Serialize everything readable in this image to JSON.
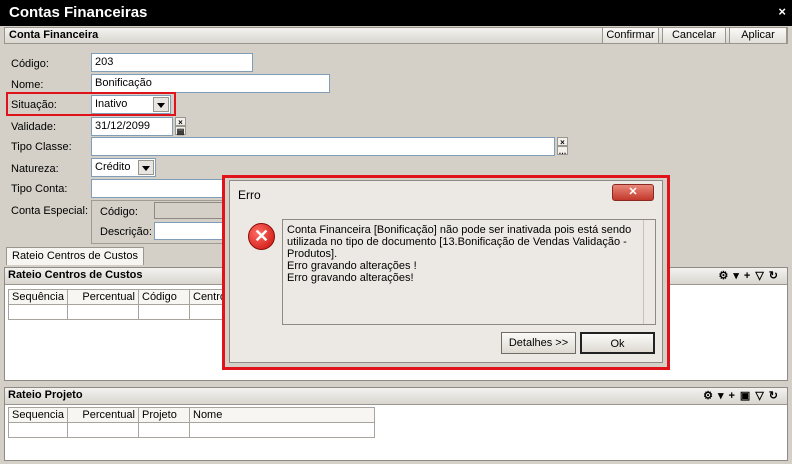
{
  "window": {
    "title": "Contas Financeiras",
    "close": "×"
  },
  "form": {
    "header": "Conta Financeira",
    "confirm": "Confirmar",
    "cancel": "Cancelar",
    "apply": "Aplicar",
    "codigo_label": "Código:",
    "codigo_value": "203",
    "nome_label": "Nome:",
    "nome_value": "Bonificação",
    "situacao_label": "Situação:",
    "situacao_value": "Inativo",
    "validade_label": "Validade:",
    "validade_value": "31/12/2099",
    "tipo_classe_label": "Tipo Classe:",
    "tipo_classe_value": "",
    "natureza_label": "Natureza:",
    "natureza_value": "Crédito",
    "tipo_conta_label": "Tipo Conta:",
    "conta_especial_label": "Conta Especial:",
    "ce_codigo_label": "Código:",
    "ce_descricao_label": "Descrição:"
  },
  "tabs": [
    {
      "label": "Rateio Centros de Custos"
    }
  ],
  "rateio_cc": {
    "title": "Rateio Centros de Custos",
    "columns": [
      "Sequência",
      "Percentual",
      "Código",
      "Centro"
    ]
  },
  "rateio_projeto": {
    "title": "Rateio Projeto",
    "columns": [
      "Sequencia",
      "Percentual",
      "Projeto",
      "Nome"
    ]
  },
  "dialog": {
    "title": "Erro",
    "message_lines": [
      "Conta Financeira [Bonificação] não pode ser inativada pois está sendo",
      "utilizada no tipo de documento [13.Bonificação de Vendas Validação -",
      "Produtos].",
      "Erro gravando alterações !",
      "Erro gravando alterações!"
    ],
    "details_button": "Detalhes >>",
    "ok_button": "Ok"
  },
  "colors": {
    "highlight": "#e0131b",
    "title_bg": "#000000"
  }
}
